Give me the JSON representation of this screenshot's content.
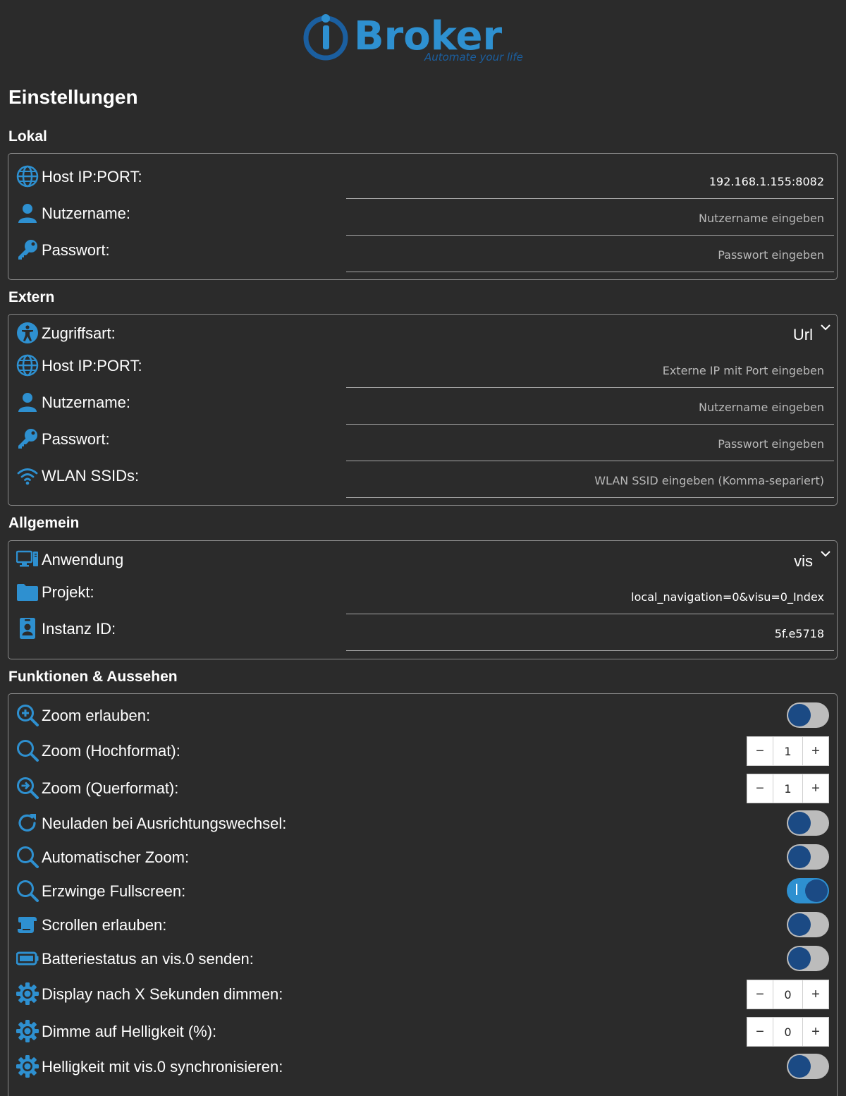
{
  "app": {
    "logo_text": "Broker",
    "logo_tagline": "Automate your life",
    "page_title": "Einstellungen"
  },
  "colors": {
    "accent": "#2e90d0",
    "knob": "#1b4a84",
    "background": "#2b2b2b"
  },
  "lokal": {
    "title": "Lokal",
    "host_label": "Host IP:PORT:",
    "host_value": "192.168.1.155:8082",
    "host_placeholder": "",
    "user_label": "Nutzername:",
    "user_value": "",
    "user_placeholder": "Nutzername eingeben",
    "pass_label": "Passwort:",
    "pass_value": "",
    "pass_placeholder": "Passwort eingeben"
  },
  "extern": {
    "title": "Extern",
    "access_label": "Zugriffsart:",
    "access_value": "Url",
    "host_label": "Host IP:PORT:",
    "host_value": "",
    "host_placeholder": "Externe IP mit Port eingeben",
    "user_label": "Nutzername:",
    "user_value": "",
    "user_placeholder": "Nutzername eingeben",
    "pass_label": "Passwort:",
    "pass_value": "",
    "pass_placeholder": "Passwort eingeben",
    "ssid_label": "WLAN SSIDs:",
    "ssid_value": "",
    "ssid_placeholder": "WLAN SSID eingeben (Komma-separiert)"
  },
  "allgemein": {
    "title": "Allgemein",
    "app_label": "Anwendung",
    "app_value": "vis",
    "project_label": "Projekt:",
    "project_value": "local_navigation=0&visu=0_Index",
    "instance_label": "Instanz ID:",
    "instance_value": "5f.e5718"
  },
  "funktionen": {
    "title": "Funktionen & Aussehen",
    "zoom_allow_label": "Zoom erlauben:",
    "zoom_allow_on": false,
    "zoom_portrait_label": "Zoom (Hochformat):",
    "zoom_portrait_value": "1",
    "zoom_landscape_label": "Zoom (Querformat):",
    "zoom_landscape_value": "1",
    "reload_label": "Neuladen bei Ausrichtungswechsel:",
    "reload_on": false,
    "autozoom_label": "Automatischer Zoom:",
    "autozoom_on": false,
    "fullscreen_label": "Erzwinge Fullscreen:",
    "fullscreen_on": true,
    "scroll_label": "Scrollen erlauben:",
    "scroll_on": false,
    "battery_label": "Batteriestatus an vis.0 senden:",
    "battery_on": false,
    "dim_seconds_label": "Display nach X Sekunden dimmen:",
    "dim_seconds_value": "0",
    "dim_brightness_label": "Dimme auf Helligkeit (%):",
    "dim_brightness_value": "0",
    "sync_brightness_label": "Helligkeit mit vis.0 synchronisieren:",
    "sync_brightness_on": false
  },
  "stepper": {
    "minus": "−",
    "plus": "+"
  }
}
